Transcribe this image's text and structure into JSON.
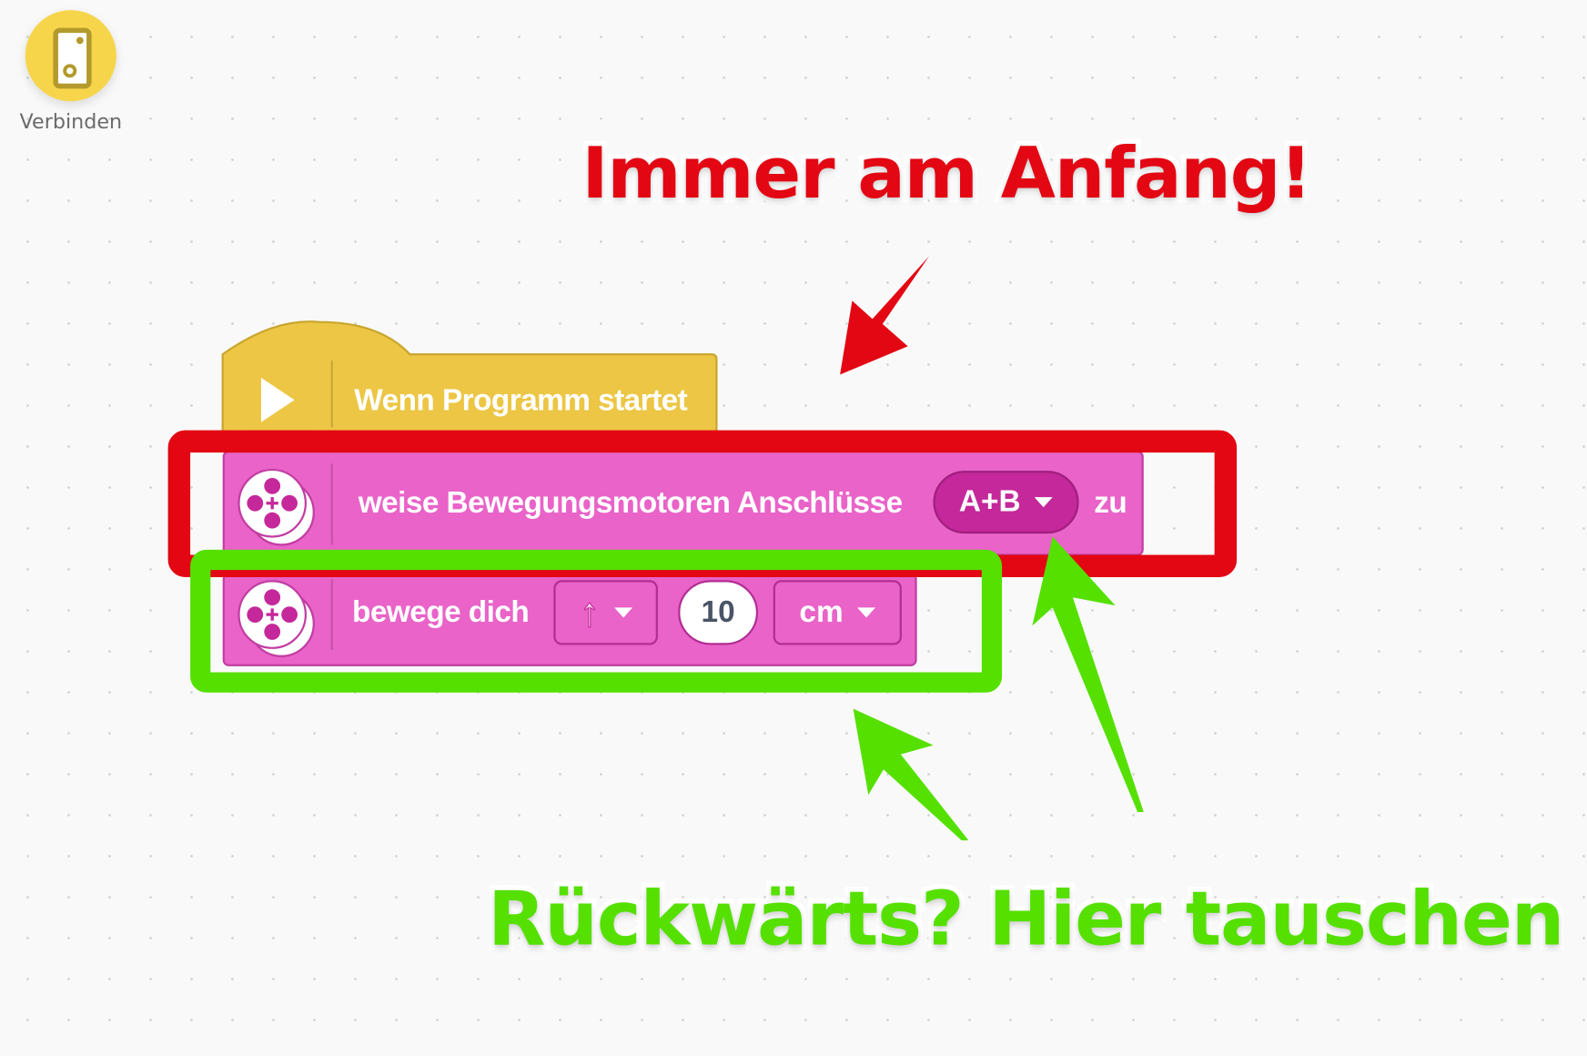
{
  "toolbar": {
    "connect_label": "Verbinden",
    "connect_icon": "phone-hub-icon"
  },
  "annotations": {
    "top": "Immer am Anfang!",
    "bottom": "Rückwärts? Hier tauschen",
    "top_color": "#e30613",
    "bottom_color": "#55e000"
  },
  "blocks": {
    "hat": {
      "label": "Wenn Programm startet",
      "icon": "play-icon",
      "color": "#ecc644"
    },
    "set_motors": {
      "label": "weise Bewegungsmotoren Anschlüsse",
      "ports": "A+B",
      "suffix": "zu",
      "color": "#e963c8"
    },
    "move": {
      "label": "bewege dich",
      "direction": "↑",
      "distance": "10",
      "unit": "cm",
      "color": "#e963c8"
    }
  }
}
